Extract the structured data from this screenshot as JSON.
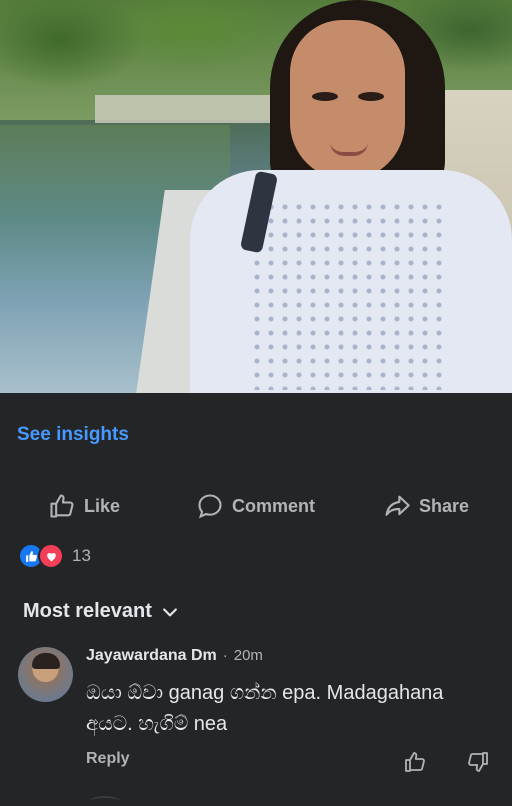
{
  "post": {
    "insights_label": "See insights",
    "actions": {
      "like": "Like",
      "comment": "Comment",
      "share": "Share"
    },
    "reactions": {
      "types": [
        "like",
        "love"
      ],
      "count": "13"
    }
  },
  "comments": {
    "sort_label": "Most relevant",
    "items": [
      {
        "author": "Jayawardana Dm",
        "separator": "·",
        "time": "20m",
        "text": "ඔයා ඕවා ganag ගන්න epa. Madagahana අයට. හැගිම් nea",
        "reply_label": "Reply"
      }
    ]
  },
  "colors": {
    "background": "#242526",
    "link": "#4599ff",
    "like_blue": "#1877f2",
    "love_red": "#f33e58"
  }
}
